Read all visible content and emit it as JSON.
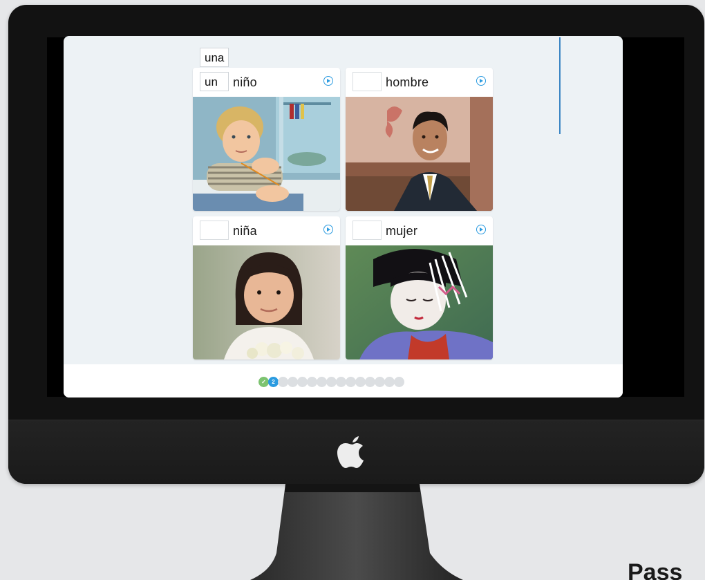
{
  "lesson": {
    "word_bank": [
      "una",
      "un"
    ],
    "cards": [
      {
        "word": "niño",
        "filled": "un",
        "photo": "boy-photo"
      },
      {
        "word": "hombre",
        "filled": "",
        "photo": "man-photo"
      },
      {
        "word": "niña",
        "filled": "",
        "photo": "girl-photo"
      },
      {
        "word": "mujer",
        "filled": "",
        "photo": "woman-photo"
      }
    ]
  },
  "progress": {
    "total_steps": 15,
    "completed_steps": 1,
    "current_step": 2,
    "current_label": "2"
  },
  "colors": {
    "accent_blue": "#2b9be0",
    "complete_green": "#7dc370",
    "app_background": "#edf2f5"
  },
  "icons": {
    "play": "play-circle-icon",
    "check": "check-icon",
    "apple": "apple-logo"
  }
}
